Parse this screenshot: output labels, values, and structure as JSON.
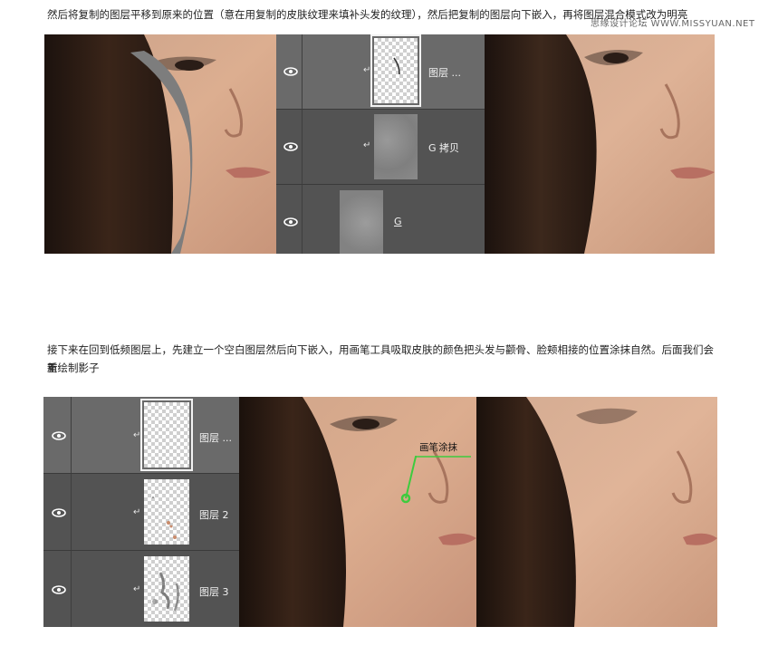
{
  "watermark": "思缘设计论坛 WWW.MISSYUAN.NET",
  "paragraph1": "然后将复制的图层平移到原来的位置（意在用复制的皮肤纹理来填补头发的纹理），然后把复制的图层向下嵌入，再将图层混合模式改为明亮",
  "paragraph2_line1": "接下来在回到低频图层上，先建立一个空白图层然后向下嵌入，用画笔工具吸取皮肤的颜色把头发与颧骨、脸颊相接的位置涂抹自然。后面我们会重",
  "paragraph2_line2": "新绘制影子",
  "panel1": {
    "layers": [
      {
        "name": "图层 ...",
        "clipped": true,
        "selected": true
      },
      {
        "name": "G 拷贝",
        "clipped": true,
        "selected": false
      },
      {
        "name": "G",
        "clipped": false,
        "selected": false
      }
    ],
    "clip_glyph": "↵"
  },
  "panel2": {
    "layers": [
      {
        "name": "图层 ...",
        "clipped": true,
        "selected": true
      },
      {
        "name": "图层 2",
        "clipped": true,
        "selected": false
      },
      {
        "name": "图层 3",
        "clipped": true,
        "selected": false
      }
    ],
    "clip_glyph": "↵"
  },
  "annotation": {
    "label": "画笔涂抹",
    "color": "#3ecb3e"
  },
  "colors": {
    "panel_bg": "#535353",
    "panel_selected": "#6a6a6a",
    "skin": "#d9a98a",
    "hair": "#2a1a14"
  }
}
